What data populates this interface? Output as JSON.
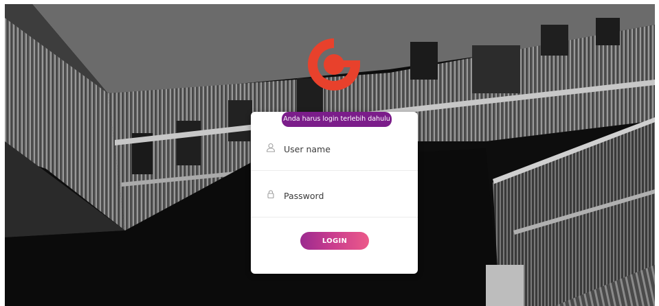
{
  "alert": {
    "text": "Anda harus login terlebih dahulu"
  },
  "login_form": {
    "username": {
      "placeholder": "User name",
      "value": "",
      "icon": "user-icon"
    },
    "password": {
      "placeholder": "Password",
      "value": "",
      "icon": "lock-icon"
    },
    "submit_label": "LOGIN"
  },
  "brand": {
    "logo_icon": "brand-logo-icon",
    "accent": "#e8412c",
    "alert_color": "#7b1d8a",
    "button_gradient": [
      "#9b2a8f",
      "#ec5a8a"
    ]
  }
}
